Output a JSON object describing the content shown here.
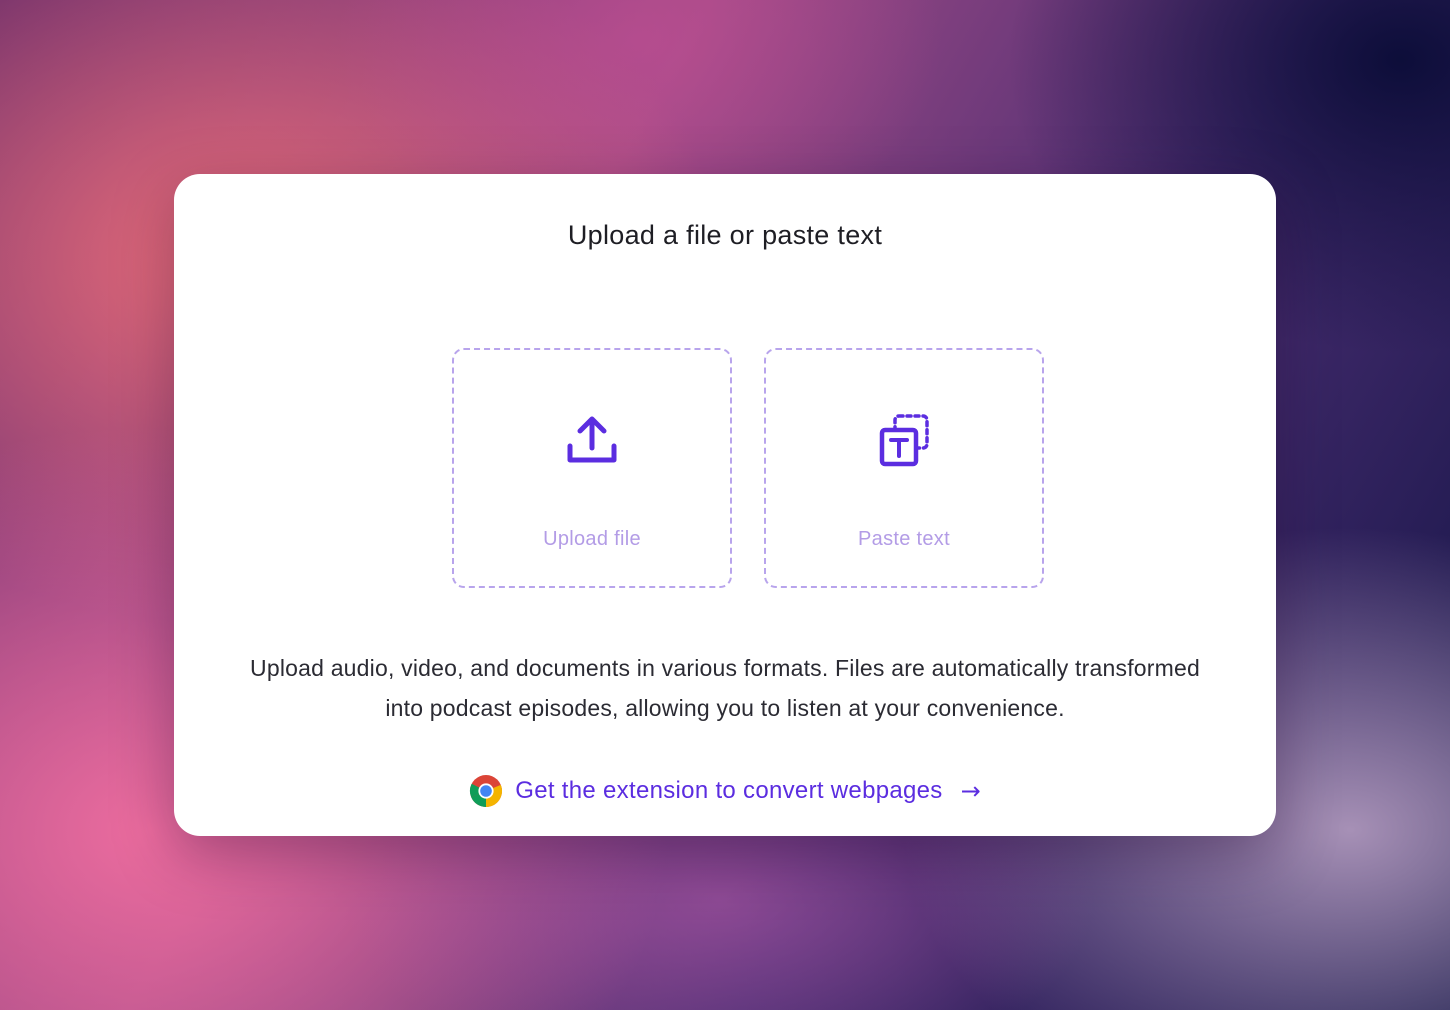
{
  "dialog": {
    "title": "Upload a file or paste text"
  },
  "options": {
    "upload": {
      "label": "Upload file",
      "icon": "upload-icon"
    },
    "paste": {
      "label": "Paste text",
      "icon": "paste-text-icon"
    }
  },
  "description": "Upload audio, video, and documents in various formats. Files are automatically transformed into podcast episodes, allowing you to listen at your convenience.",
  "extension": {
    "label": "Get the extension to convert webpages",
    "arrow": "→",
    "icon": "chrome-icon"
  },
  "colors": {
    "accent": "#5b2de0",
    "tile_border": "#b8a4ec",
    "tile_label": "#b39ce6"
  }
}
